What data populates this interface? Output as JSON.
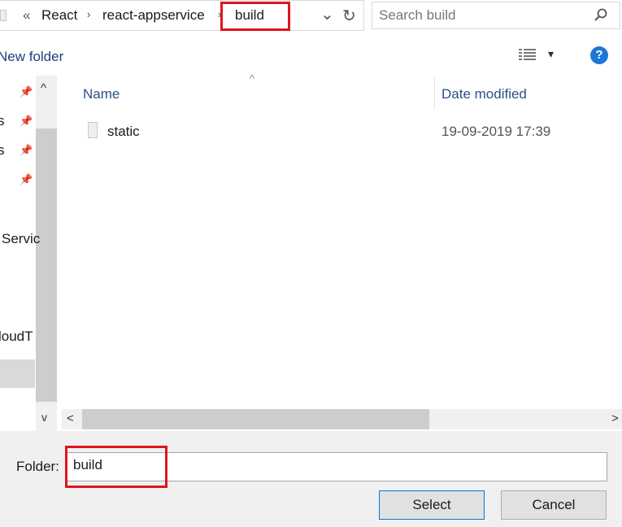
{
  "address_bar": {
    "overflow_label": "«",
    "crumbs": [
      "React",
      "react-appservice",
      "build"
    ],
    "separator": "›",
    "dropdown_glyph": "⌄",
    "refresh_glyph": "↻"
  },
  "search": {
    "placeholder": "Search build",
    "icon": "search-icon"
  },
  "toolbar": {
    "new_folder_label": "New folder",
    "view_dropdown_glyph": "▾",
    "help_label": "?"
  },
  "nav": {
    "label_services_fragment": "Servic",
    "label_cloud_fragment": "loudT",
    "partial_s_1": "s",
    "partial_s_2": "s"
  },
  "columns": {
    "name": "Name",
    "date_modified": "Date modified",
    "sort_glyph": "^"
  },
  "files": [
    {
      "name": "static",
      "date_modified": "19-09-2019 17:39"
    }
  ],
  "scroll": {
    "left": "<",
    "right": ">",
    "up": "^",
    "down": "v"
  },
  "bottom": {
    "folder_label": "Folder:",
    "folder_value": "build",
    "select_label": "Select",
    "cancel_label": "Cancel"
  },
  "colors": {
    "highlight": "#e0141e",
    "accent": "#0078d7",
    "help_blue": "#1e76d6"
  }
}
